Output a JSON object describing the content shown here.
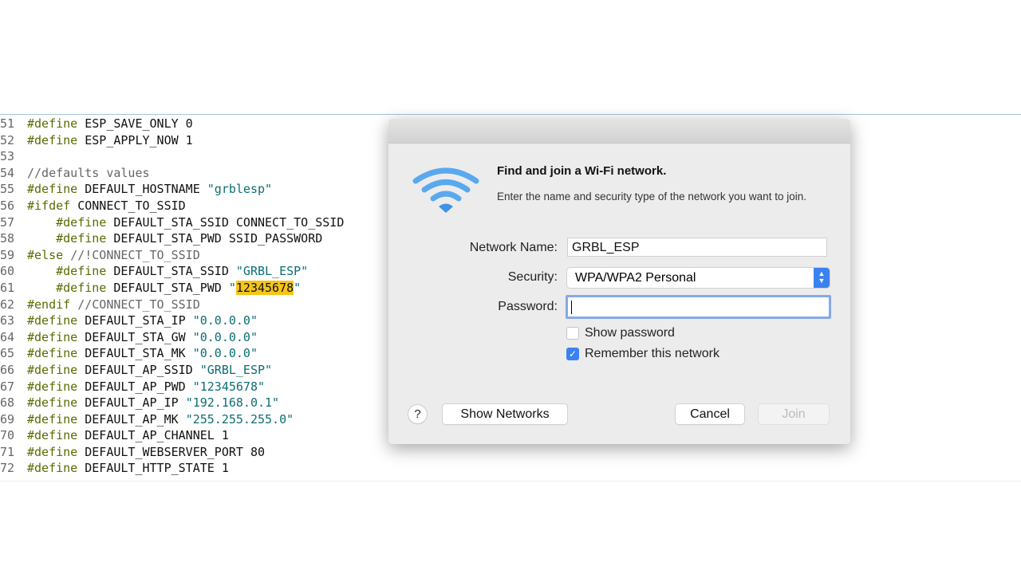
{
  "editor": {
    "lines": [
      {
        "n": "51",
        "parts": [
          [
            "kw",
            "#define"
          ],
          [
            "",
            "ESP_SAVE_ONLY 0"
          ]
        ]
      },
      {
        "n": "52",
        "parts": [
          [
            "kw",
            "#define"
          ],
          [
            "",
            "ESP_APPLY_NOW 1"
          ]
        ]
      },
      {
        "n": "53",
        "parts": []
      },
      {
        "n": "54",
        "parts": [
          [
            "cm",
            "//defaults values"
          ]
        ]
      },
      {
        "n": "55",
        "parts": [
          [
            "kw",
            "#define"
          ],
          [
            "",
            "DEFAULT_HOSTNAME "
          ],
          [
            "str",
            "\"grblesp\""
          ]
        ]
      },
      {
        "n": "56",
        "parts": [
          [
            "kw",
            "#ifdef"
          ],
          [
            "",
            "CONNECT_TO_SSID"
          ]
        ]
      },
      {
        "n": "57",
        "parts": [
          [
            "kw",
            "    #define"
          ],
          [
            "",
            "DEFAULT_STA_SSID CONNECT_TO_SSID"
          ]
        ]
      },
      {
        "n": "58",
        "parts": [
          [
            "kw",
            "    #define"
          ],
          [
            "",
            "DEFAULT_STA_PWD SSID_PASSWORD"
          ]
        ]
      },
      {
        "n": "59",
        "parts": [
          [
            "kw",
            "#else"
          ],
          [
            "cm",
            "//!CONNECT_TO_SSID"
          ]
        ]
      },
      {
        "n": "60",
        "parts": [
          [
            "kw",
            "    #define"
          ],
          [
            "",
            "DEFAULT_STA_SSID "
          ],
          [
            "str",
            "\"GRBL_ESP\""
          ]
        ]
      },
      {
        "n": "61",
        "parts": [
          [
            "kw",
            "    #define"
          ],
          [
            "",
            "DEFAULT_STA_PWD "
          ],
          [
            "str",
            "\""
          ],
          [
            "hl",
            "12345678"
          ],
          [
            "str",
            "\""
          ]
        ]
      },
      {
        "n": "62",
        "parts": [
          [
            "kw",
            "#endif"
          ],
          [
            "cm",
            "//CONNECT_TO_SSID"
          ]
        ]
      },
      {
        "n": "63",
        "parts": [
          [
            "kw",
            "#define"
          ],
          [
            "",
            "DEFAULT_STA_IP "
          ],
          [
            "str",
            "\"0.0.0.0\""
          ]
        ]
      },
      {
        "n": "64",
        "parts": [
          [
            "kw",
            "#define"
          ],
          [
            "",
            "DEFAULT_STA_GW "
          ],
          [
            "str",
            "\"0.0.0.0\""
          ]
        ]
      },
      {
        "n": "65",
        "parts": [
          [
            "kw",
            "#define"
          ],
          [
            "",
            "DEFAULT_STA_MK "
          ],
          [
            "str",
            "\"0.0.0.0\""
          ]
        ]
      },
      {
        "n": "66",
        "parts": [
          [
            "kw",
            "#define"
          ],
          [
            "",
            "DEFAULT_AP_SSID "
          ],
          [
            "str",
            "\"GRBL_ESP\""
          ]
        ]
      },
      {
        "n": "67",
        "parts": [
          [
            "kw",
            "#define"
          ],
          [
            "",
            "DEFAULT_AP_PWD "
          ],
          [
            "str",
            "\"12345678\""
          ]
        ]
      },
      {
        "n": "68",
        "parts": [
          [
            "kw",
            "#define"
          ],
          [
            "",
            "DEFAULT_AP_IP "
          ],
          [
            "str",
            "\"192.168.0.1\""
          ]
        ]
      },
      {
        "n": "69",
        "parts": [
          [
            "kw",
            "#define"
          ],
          [
            "",
            "DEFAULT_AP_MK "
          ],
          [
            "str",
            "\"255.255.255.0\""
          ]
        ]
      },
      {
        "n": "70",
        "parts": [
          [
            "kw",
            "#define"
          ],
          [
            "",
            "DEFAULT_AP_CHANNEL 1"
          ]
        ]
      },
      {
        "n": "71",
        "parts": [
          [
            "kw",
            "#define"
          ],
          [
            "",
            "DEFAULT_WEBSERVER_PORT 80"
          ]
        ]
      },
      {
        "n": "72",
        "parts": [
          [
            "kw",
            "#define"
          ],
          [
            "",
            "DEFAULT_HTTP_STATE 1"
          ]
        ]
      }
    ]
  },
  "dialog": {
    "icon": "wifi-icon",
    "heading": "Find and join a Wi-Fi network.",
    "description": "Enter the name and security type of the network you want to join.",
    "network_name_label": "Network Name:",
    "network_name_value": "GRBL_ESP",
    "security_label": "Security:",
    "security_value": "WPA/WPA2 Personal",
    "password_label": "Password:",
    "password_value": "",
    "show_password_label": "Show password",
    "show_password_checked": false,
    "remember_label": "Remember this network",
    "remember_checked": true,
    "help_label": "?",
    "show_networks_label": "Show Networks",
    "cancel_label": "Cancel",
    "join_label": "Join",
    "accent_color": "#3b82f0"
  }
}
